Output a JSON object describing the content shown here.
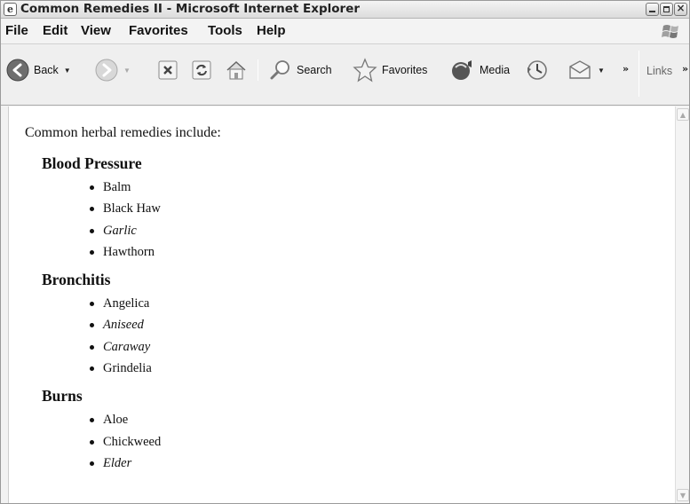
{
  "window": {
    "title": "Common Remedies II - Microsoft Internet Explorer",
    "icon": "ie-page-icon"
  },
  "menu": [
    "File",
    "Edit",
    "View",
    "Favorites",
    "Tools",
    "Help"
  ],
  "toolbar": {
    "back": "Back",
    "search": "Search",
    "favorites": "Favorites",
    "media": "Media",
    "links": "Links"
  },
  "page": {
    "intro": "Common herbal remedies include:",
    "categories": [
      {
        "name": "Blood Pressure",
        "items": [
          {
            "text": "Balm",
            "italic": false
          },
          {
            "text": "Black Haw",
            "italic": false
          },
          {
            "text": "Garlic",
            "italic": true
          },
          {
            "text": "Hawthorn",
            "italic": false
          }
        ]
      },
      {
        "name": "Bronchitis",
        "items": [
          {
            "text": "Angelica",
            "italic": false
          },
          {
            "text": "Aniseed",
            "italic": true
          },
          {
            "text": "Caraway",
            "italic": true
          },
          {
            "text": "Grindelia",
            "italic": false
          }
        ]
      },
      {
        "name": "Burns",
        "items": [
          {
            "text": "Aloe",
            "italic": false
          },
          {
            "text": "Chickweed",
            "italic": false
          },
          {
            "text": "Elder",
            "italic": true
          }
        ]
      }
    ]
  }
}
